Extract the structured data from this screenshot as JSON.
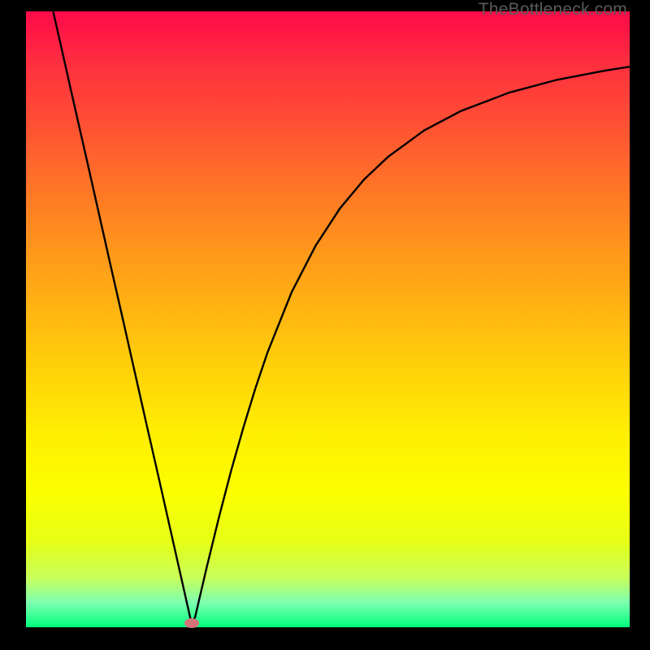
{
  "attribution": "TheBottleneck.com",
  "chart_data": {
    "type": "line",
    "title": "",
    "xlabel": "",
    "ylabel": "",
    "xlim": [
      0,
      100
    ],
    "ylim": [
      0,
      100
    ],
    "grid": false,
    "legend": false,
    "series": [
      {
        "name": "curve",
        "x": [
          4.5,
          6,
          8,
          10,
          12,
          14,
          16,
          18,
          20,
          22,
          24,
          26,
          27.4,
          28,
          30,
          32,
          34,
          36,
          38,
          40,
          44,
          48,
          52,
          56,
          60,
          66,
          72,
          80,
          88,
          96,
          100
        ],
        "y": [
          100,
          93.5,
          84.8,
          76.2,
          67.5,
          58.8,
          50.2,
          41.5,
          32.8,
          24.2,
          15.5,
          6.8,
          0.7,
          1.6,
          10,
          18,
          25.5,
          32.4,
          38.8,
          44.6,
          54.4,
          62,
          68,
          72.7,
          76.4,
          80.7,
          83.8,
          86.8,
          88.9,
          90.4,
          91
        ],
        "color": "#000000"
      }
    ],
    "markers": [
      {
        "name": "min-point",
        "x": 27.4,
        "y": 0.7,
        "color": "#d5737b"
      }
    ],
    "background_gradient": {
      "direction": "vertical",
      "stops": [
        {
          "pos": 0.0,
          "color": "#ff0a4a"
        },
        {
          "pos": 0.5,
          "color": "#ffb312"
        },
        {
          "pos": 0.78,
          "color": "#fcff00"
        },
        {
          "pos": 1.0,
          "color": "#00ff7b"
        }
      ]
    }
  }
}
